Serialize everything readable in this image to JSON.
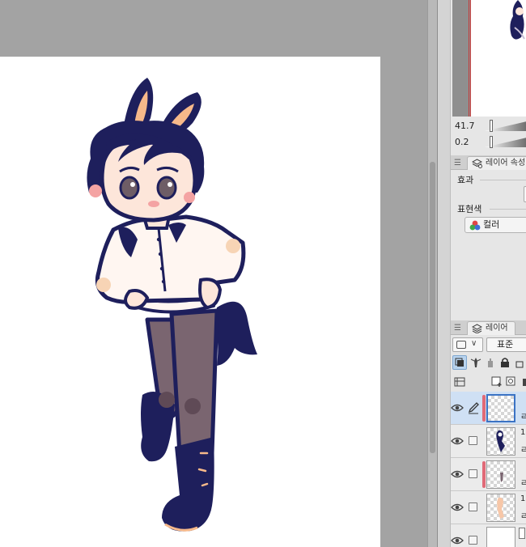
{
  "sliders": {
    "zoom_value": "41.7",
    "rotate_value": "0.2"
  },
  "layer_property_panel": {
    "tab_label": "레이어 속성",
    "effect_label": "효과",
    "expression_color_label": "표현색",
    "color_button_label": "컬러"
  },
  "layer_panel": {
    "tab_label": "레이어",
    "blend_mode": "표준",
    "layers": [
      {
        "name": "",
        "sub": "ㄹ",
        "selected": true,
        "clip": true
      },
      {
        "name": "1",
        "sub": "ㄹ",
        "selected": false,
        "clip": false
      },
      {
        "name": "",
        "sub": "ㄹ",
        "selected": false,
        "clip": true
      },
      {
        "name": "1",
        "sub": "ㄹ",
        "selected": false,
        "clip": false
      },
      {
        "name": "",
        "sub": "",
        "selected": false,
        "clip": false
      }
    ]
  },
  "colors": {
    "navy_outline": "#1e1f5c",
    "skin": "#fde6da",
    "pants": "#7a6570",
    "shirt": "#fff6f1",
    "accent_orange": "#f7b98a",
    "selection_blue": "#3b73c4",
    "clip_red": "#e06a77"
  },
  "icons": {
    "eye": "eye-icon",
    "pen": "pen-icon",
    "lock": "lock-icon",
    "layer_stack": "layer-stack-icon",
    "color_wheel": "color-wheel-icon"
  }
}
